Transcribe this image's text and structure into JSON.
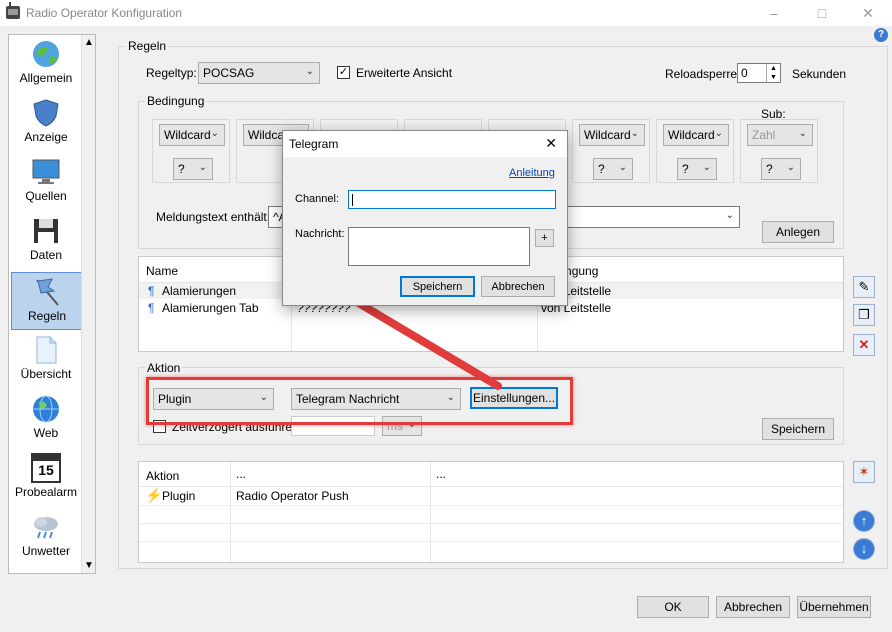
{
  "window": {
    "title": "Radio Operator Konfiguration"
  },
  "sidebar": {
    "items": [
      {
        "label": "Allgemein"
      },
      {
        "label": "Anzeige"
      },
      {
        "label": "Quellen"
      },
      {
        "label": "Daten"
      },
      {
        "label": "Regeln"
      },
      {
        "label": "Übersicht"
      },
      {
        "label": "Web"
      },
      {
        "label": "Probealarm"
      },
      {
        "label": "Unwetter"
      }
    ],
    "calendar_day": "15"
  },
  "regeln": {
    "group_label": "Regeln",
    "regeltyp_label": "Regeltyp:",
    "regeltyp_value": "POCSAG",
    "erweiterte_label": "Erweiterte Ansicht",
    "erweiterte_checked": "✓",
    "reloadsperre_label": "Reloadsperre:",
    "reloadsperre_value": "0",
    "sekunden_label": "Sekunden"
  },
  "bedingung": {
    "group_label": "Bedingung",
    "sub_label": "Sub:",
    "combos": [
      "Wildcard",
      "Wildcard",
      "Wildcard",
      "Wildcard",
      "Wildcard",
      "Wildcard",
      "Wildcard",
      "Zahl"
    ],
    "q_value": "?",
    "meldungstext_label": "Meldungstext enthält:",
    "meldungstext_value": "^A",
    "anlegen_label": "Anlegen"
  },
  "rules_list": {
    "col_name": "Name",
    "col_bedingung": "Bedingung",
    "rows": [
      {
        "name": "Alamierungen",
        "mid": "",
        "cond": "von Leitstelle"
      },
      {
        "name": "Alamierungen Tab",
        "mid": "????????",
        "cond": "von Leitstelle"
      }
    ]
  },
  "aktion": {
    "group_label": "Aktion",
    "type_value": "Plugin",
    "plugin_value": "Telegram Nachricht",
    "einstellungen_label": "Einstellungen...",
    "zeitverzoegert_label": "Zeitverzögert ausführen",
    "unit_value": "ms",
    "speichern_label": "Speichern"
  },
  "actions_list": {
    "col_aktion": "Aktion",
    "col_2": "...",
    "col_3": "...",
    "rows": [
      {
        "type": "Plugin",
        "value": "Radio Operator Push"
      }
    ]
  },
  "footer": {
    "ok": "OK",
    "abbrechen": "Abbrechen",
    "uebernehmen": "Übernehmen"
  },
  "dialog": {
    "title": "Telegram",
    "anleitung": "Anleitung",
    "channel_label": "Channel:",
    "channel_value": "",
    "nachricht_label": "Nachricht:",
    "plus": "+",
    "speichern": "Speichern",
    "abbrechen": "Abbrechen"
  },
  "colors": {
    "accent": "#0078d7",
    "highlight_red": "#e03c3c",
    "active_nav": "#bcd3ee"
  }
}
